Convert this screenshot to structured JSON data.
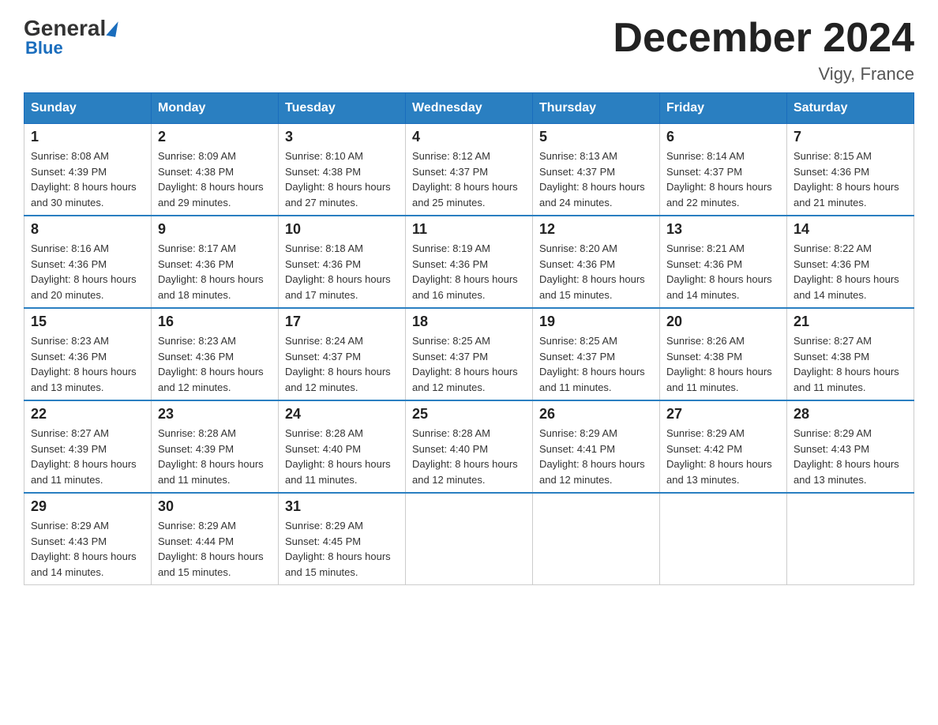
{
  "logo": {
    "general": "General",
    "blue": "Blue"
  },
  "header": {
    "title": "December 2024",
    "subtitle": "Vigy, France"
  },
  "days_of_week": [
    "Sunday",
    "Monday",
    "Tuesday",
    "Wednesday",
    "Thursday",
    "Friday",
    "Saturday"
  ],
  "weeks": [
    [
      {
        "day": "1",
        "sunrise": "8:08 AM",
        "sunset": "4:39 PM",
        "daylight": "8 hours and 30 minutes."
      },
      {
        "day": "2",
        "sunrise": "8:09 AM",
        "sunset": "4:38 PM",
        "daylight": "8 hours and 29 minutes."
      },
      {
        "day": "3",
        "sunrise": "8:10 AM",
        "sunset": "4:38 PM",
        "daylight": "8 hours and 27 minutes."
      },
      {
        "day": "4",
        "sunrise": "8:12 AM",
        "sunset": "4:37 PM",
        "daylight": "8 hours and 25 minutes."
      },
      {
        "day": "5",
        "sunrise": "8:13 AM",
        "sunset": "4:37 PM",
        "daylight": "8 hours and 24 minutes."
      },
      {
        "day": "6",
        "sunrise": "8:14 AM",
        "sunset": "4:37 PM",
        "daylight": "8 hours and 22 minutes."
      },
      {
        "day": "7",
        "sunrise": "8:15 AM",
        "sunset": "4:36 PM",
        "daylight": "8 hours and 21 minutes."
      }
    ],
    [
      {
        "day": "8",
        "sunrise": "8:16 AM",
        "sunset": "4:36 PM",
        "daylight": "8 hours and 20 minutes."
      },
      {
        "day": "9",
        "sunrise": "8:17 AM",
        "sunset": "4:36 PM",
        "daylight": "8 hours and 18 minutes."
      },
      {
        "day": "10",
        "sunrise": "8:18 AM",
        "sunset": "4:36 PM",
        "daylight": "8 hours and 17 minutes."
      },
      {
        "day": "11",
        "sunrise": "8:19 AM",
        "sunset": "4:36 PM",
        "daylight": "8 hours and 16 minutes."
      },
      {
        "day": "12",
        "sunrise": "8:20 AM",
        "sunset": "4:36 PM",
        "daylight": "8 hours and 15 minutes."
      },
      {
        "day": "13",
        "sunrise": "8:21 AM",
        "sunset": "4:36 PM",
        "daylight": "8 hours and 14 minutes."
      },
      {
        "day": "14",
        "sunrise": "8:22 AM",
        "sunset": "4:36 PM",
        "daylight": "8 hours and 14 minutes."
      }
    ],
    [
      {
        "day": "15",
        "sunrise": "8:23 AM",
        "sunset": "4:36 PM",
        "daylight": "8 hours and 13 minutes."
      },
      {
        "day": "16",
        "sunrise": "8:23 AM",
        "sunset": "4:36 PM",
        "daylight": "8 hours and 12 minutes."
      },
      {
        "day": "17",
        "sunrise": "8:24 AM",
        "sunset": "4:37 PM",
        "daylight": "8 hours and 12 minutes."
      },
      {
        "day": "18",
        "sunrise": "8:25 AM",
        "sunset": "4:37 PM",
        "daylight": "8 hours and 12 minutes."
      },
      {
        "day": "19",
        "sunrise": "8:25 AM",
        "sunset": "4:37 PM",
        "daylight": "8 hours and 11 minutes."
      },
      {
        "day": "20",
        "sunrise": "8:26 AM",
        "sunset": "4:38 PM",
        "daylight": "8 hours and 11 minutes."
      },
      {
        "day": "21",
        "sunrise": "8:27 AM",
        "sunset": "4:38 PM",
        "daylight": "8 hours and 11 minutes."
      }
    ],
    [
      {
        "day": "22",
        "sunrise": "8:27 AM",
        "sunset": "4:39 PM",
        "daylight": "8 hours and 11 minutes."
      },
      {
        "day": "23",
        "sunrise": "8:28 AM",
        "sunset": "4:39 PM",
        "daylight": "8 hours and 11 minutes."
      },
      {
        "day": "24",
        "sunrise": "8:28 AM",
        "sunset": "4:40 PM",
        "daylight": "8 hours and 11 minutes."
      },
      {
        "day": "25",
        "sunrise": "8:28 AM",
        "sunset": "4:40 PM",
        "daylight": "8 hours and 12 minutes."
      },
      {
        "day": "26",
        "sunrise": "8:29 AM",
        "sunset": "4:41 PM",
        "daylight": "8 hours and 12 minutes."
      },
      {
        "day": "27",
        "sunrise": "8:29 AM",
        "sunset": "4:42 PM",
        "daylight": "8 hours and 13 minutes."
      },
      {
        "day": "28",
        "sunrise": "8:29 AM",
        "sunset": "4:43 PM",
        "daylight": "8 hours and 13 minutes."
      }
    ],
    [
      {
        "day": "29",
        "sunrise": "8:29 AM",
        "sunset": "4:43 PM",
        "daylight": "8 hours and 14 minutes."
      },
      {
        "day": "30",
        "sunrise": "8:29 AM",
        "sunset": "4:44 PM",
        "daylight": "8 hours and 15 minutes."
      },
      {
        "day": "31",
        "sunrise": "8:29 AM",
        "sunset": "4:45 PM",
        "daylight": "8 hours and 15 minutes."
      },
      null,
      null,
      null,
      null
    ]
  ],
  "labels": {
    "sunrise": "Sunrise:",
    "sunset": "Sunset:",
    "daylight": "Daylight:"
  }
}
